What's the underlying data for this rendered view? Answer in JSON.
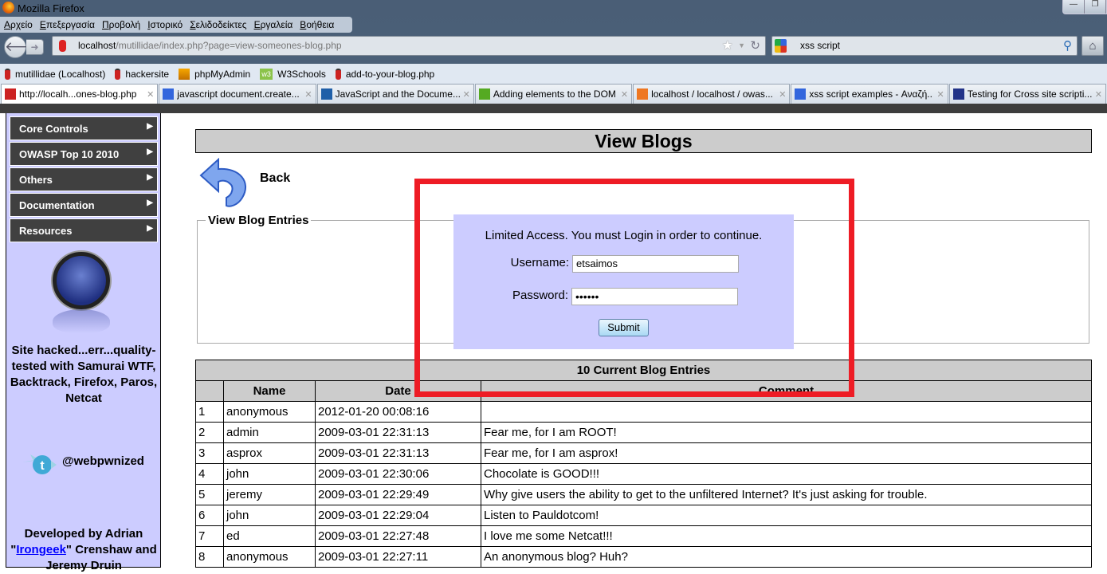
{
  "window": {
    "title": "Mozilla Firefox"
  },
  "menu": [
    "Αρχείο",
    "Επεξεργασία",
    "Προβολή",
    "Ιστορικό",
    "Σελιδοδείκτες",
    "Εργαλεία",
    "Βοήθεια"
  ],
  "url": {
    "host": "localhost",
    "path": "/mutillidae/index.php?page=view-someones-blog.php"
  },
  "search": {
    "value": "xss script"
  },
  "bookmarks": [
    {
      "label": "mutillidae (Localhost)",
      "icon": "bug-icon"
    },
    {
      "label": "hackersite",
      "icon": "bug-icon"
    },
    {
      "label": "phpMyAdmin",
      "icon": "pma-icon"
    },
    {
      "label": "W3Schools",
      "icon": "w3-icon"
    },
    {
      "label": "add-to-your-blog.php",
      "icon": "bug-icon"
    }
  ],
  "tabs": [
    {
      "label": "http://localh...ones-blog.php",
      "color": "#cc2222"
    },
    {
      "label": "javascript document.create...",
      "color": "#3366dd"
    },
    {
      "label": "JavaScript and the Docume...",
      "color": "#1f5fa8"
    },
    {
      "label": "Adding elements to the DOM",
      "color": "#55aa22"
    },
    {
      "label": "localhost / localhost / owas...",
      "color": "#ee7722"
    },
    {
      "label": "xss script examples - Αναζή...",
      "color": "#3366dd"
    },
    {
      "label": "Testing for Cross site scripti...",
      "color": "#223388"
    }
  ],
  "sidebar": {
    "items": [
      "Core Controls",
      "OWASP Top 10 2010",
      "Others",
      "Documentation",
      "Resources"
    ],
    "tagline": "Site hacked...err...quality-tested with Samurai WTF, Backtrack, Firefox, Paros, Netcat",
    "twitter": "@webpwnized",
    "dev_prefix": "Developed by Adrian \"",
    "dev_link": "Irongeek",
    "dev_suffix": "\" Crenshaw and Jeremy Druin"
  },
  "main": {
    "title": "View Blogs",
    "back": "Back",
    "legend": "View Blog Entries"
  },
  "login": {
    "message": "Limited Access. You must Login in order to continue.",
    "username_label": "Username:",
    "username_value": "etsaimos",
    "password_label": "Password:",
    "password_value": "••••••",
    "submit": "Submit"
  },
  "annotation_color": "#ee1c25",
  "table": {
    "caption": "10 Current Blog Entries",
    "headers": [
      "",
      "Name",
      "Date",
      "Comment"
    ],
    "rows": [
      [
        "1",
        "anonymous",
        "2012-01-20 00:08:16",
        ""
      ],
      [
        "2",
        "admin",
        "2009-03-01 22:31:13",
        "Fear me, for I am ROOT!"
      ],
      [
        "3",
        "asprox",
        "2009-03-01 22:31:13",
        "Fear me, for I am asprox!"
      ],
      [
        "4",
        "john",
        "2009-03-01 22:30:06",
        "Chocolate is GOOD!!!"
      ],
      [
        "5",
        "jeremy",
        "2009-03-01 22:29:49",
        "Why give users the ability to get to the unfiltered Internet? It's just asking for trouble."
      ],
      [
        "6",
        "john",
        "2009-03-01 22:29:04",
        "Listen to Pauldotcom!"
      ],
      [
        "7",
        "ed",
        "2009-03-01 22:27:48",
        "I love me some Netcat!!!"
      ],
      [
        "8",
        "anonymous",
        "2009-03-01 22:27:11",
        "An anonymous blog? Huh?"
      ]
    ]
  }
}
